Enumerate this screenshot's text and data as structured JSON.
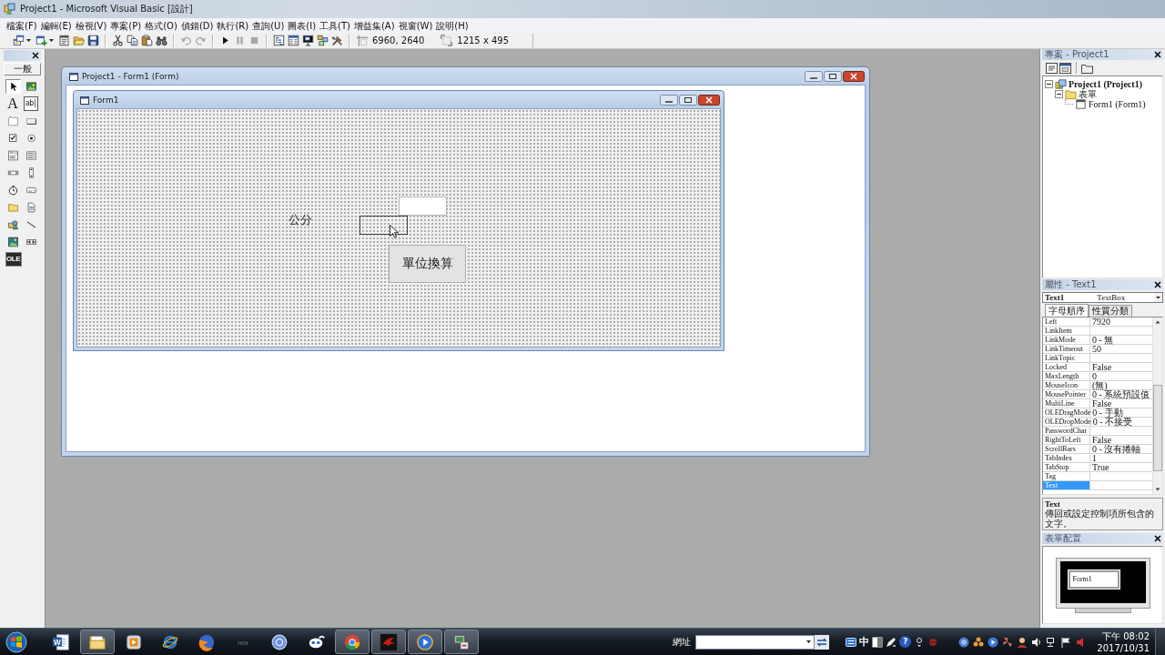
{
  "window": {
    "title": "Project1 - Microsoft Visual Basic [設計]"
  },
  "menu": [
    "檔案(F)",
    "編輯(E)",
    "檢視(V)",
    "專案(P)",
    "格式(O)",
    "偵錯(D)",
    "執行(R)",
    "查詢(U)",
    "圖表(I)",
    "工具(T)",
    "增益集(A)",
    "視窗(W)",
    "說明(H)"
  ],
  "toolbar": {
    "groups": [
      [
        {
          "kind": "addproject",
          "dropdown": true,
          "disabled": false
        },
        {
          "kind": "addform",
          "dropdown": true,
          "disabled": false
        },
        {
          "kind": "menueditor",
          "dropdown": false,
          "disabled": false
        },
        {
          "kind": "open",
          "dropdown": false,
          "disabled": false
        },
        {
          "kind": "save",
          "dropdown": false,
          "disabled": false
        }
      ],
      [
        {
          "kind": "cut",
          "dropdown": false,
          "disabled": false
        },
        {
          "kind": "copy",
          "dropdown": false,
          "disabled": false
        },
        {
          "kind": "paste",
          "dropdown": false,
          "disabled": false
        },
        {
          "kind": "find",
          "dropdown": false,
          "disabled": false
        }
      ],
      [
        {
          "kind": "undo",
          "dropdown": false,
          "disabled": true
        },
        {
          "kind": "redo",
          "dropdown": false,
          "disabled": true
        }
      ],
      [
        {
          "kind": "run",
          "dropdown": false,
          "disabled": false
        },
        {
          "kind": "pause",
          "dropdown": false,
          "disabled": true
        },
        {
          "kind": "stop",
          "dropdown": false,
          "disabled": true
        }
      ],
      [
        {
          "kind": "projectexplorer",
          "dropdown": false,
          "disabled": false
        },
        {
          "kind": "properties",
          "dropdown": false,
          "disabled": false
        },
        {
          "kind": "formlayout",
          "dropdown": false,
          "disabled": false
        },
        {
          "kind": "objectbrowser",
          "dropdown": false,
          "disabled": false
        },
        {
          "kind": "toolbox",
          "dropdown": false,
          "disabled": false
        }
      ]
    ],
    "position": "6960, 2640",
    "size": "1215 x 495"
  },
  "toolbox": {
    "tab": "一般",
    "tools": [
      {
        "kind": "pointer",
        "selected": true
      },
      {
        "kind": "picture",
        "selected": false
      },
      {
        "kind": "label",
        "glyph": "A",
        "selected": false
      },
      {
        "kind": "textbox",
        "glyph": "ab|",
        "selected": false
      },
      {
        "kind": "frame",
        "selected": false
      },
      {
        "kind": "command",
        "selected": false
      },
      {
        "kind": "check",
        "selected": false
      },
      {
        "kind": "option",
        "selected": false
      },
      {
        "kind": "combo",
        "selected": false
      },
      {
        "kind": "list",
        "selected": false
      },
      {
        "kind": "hscroll",
        "selected": false
      },
      {
        "kind": "vscroll",
        "selected": false
      },
      {
        "kind": "timer",
        "selected": false
      },
      {
        "kind": "drive",
        "selected": false
      },
      {
        "kind": "dir",
        "selected": false
      },
      {
        "kind": "file",
        "selected": false
      },
      {
        "kind": "shape",
        "selected": false
      },
      {
        "kind": "line",
        "selected": false
      },
      {
        "kind": "image",
        "selected": false
      },
      {
        "kind": "data",
        "selected": false
      },
      {
        "kind": "ole",
        "glyph": "OLE",
        "selected": false
      }
    ]
  },
  "designer": {
    "title": "Project1 - Form1 (Form)",
    "form": {
      "title": "Form1",
      "controls": [
        {
          "kind": "label",
          "text": "公分",
          "selected": false
        },
        {
          "kind": "textbox",
          "selected": false
        },
        {
          "kind": "textbox",
          "selected": true
        },
        {
          "kind": "button",
          "text": "單位換算",
          "selected": false
        }
      ]
    }
  },
  "project_explorer": {
    "title": "專案 - Project1",
    "tree": [
      {
        "kind": "project",
        "label": "Project1 (Project1)",
        "expanded": true,
        "children": [
          {
            "kind": "folder",
            "label": "表單",
            "expanded": true,
            "children": [
              {
                "kind": "form",
                "label": "Form1 (Form1)"
              }
            ]
          }
        ]
      }
    ]
  },
  "properties": {
    "title": "屬性 - Text1",
    "object": "**Text1**  TextBox",
    "tabs": [
      {
        "label": "字母順序",
        "selected": true
      },
      {
        "label": "性質分類",
        "selected": false
      }
    ],
    "rows": [
      {
        "name": "Left",
        "value": "7920",
        "selected": false
      },
      {
        "name": "LinkItem",
        "selected": false
      },
      {
        "name": "LinkMode",
        "value": "0 - 無",
        "selected": false
      },
      {
        "name": "LinkTimeout",
        "value": "50",
        "selected": false
      },
      {
        "name": "LinkTopic",
        "selected": false
      },
      {
        "name": "Locked",
        "value": "False",
        "selected": false
      },
      {
        "name": "MaxLength",
        "value": "0",
        "selected": false
      },
      {
        "name": "MouseIcon",
        "value": "(無)",
        "selected": false
      },
      {
        "name": "MousePointer",
        "value": "0 - 系統預設值",
        "selected": false
      },
      {
        "name": "MultiLine",
        "value": "False",
        "selected": false
      },
      {
        "name": "OLEDragMode",
        "value": "0 - 手動",
        "selected": false
      },
      {
        "name": "OLEDropMode",
        "value": "0 - 不接受",
        "selected": false
      },
      {
        "name": "PasswordChar",
        "selected": false
      },
      {
        "name": "RightToLeft",
        "value": "False",
        "selected": false
      },
      {
        "name": "ScrollBars",
        "value": "0 - 沒有捲軸",
        "selected": false
      },
      {
        "name": "TabIndex",
        "value": "1",
        "selected": false
      },
      {
        "name": "TabStop",
        "value": "True",
        "selected": false
      },
      {
        "name": "Tag",
        "selected": false
      },
      {
        "name": "Text",
        "selected": true
      }
    ],
    "description": {
      "title": "Text",
      "text": "傳回或設定控制項所包含的文字。"
    }
  },
  "form_layout": {
    "title": "表單配置",
    "form_label": "Form1"
  },
  "taskbar": {
    "apps": [
      {
        "kind": "document",
        "glyph": "W",
        "running": false
      },
      {
        "kind": "folder",
        "running": true
      },
      {
        "kind": "playtile",
        "running": false
      },
      {
        "kind": "orbit",
        "running": false
      },
      {
        "kind": "foxglobe",
        "running": false
      },
      {
        "kind": "wordmark",
        "glyph": "nox",
        "running": false
      },
      {
        "kind": "disc",
        "running": false
      },
      {
        "kind": "bird",
        "running": false
      },
      {
        "kind": "tricolor",
        "running": true
      },
      {
        "kind": "dragon",
        "running": true
      },
      {
        "kind": "playdisc",
        "running": true
      },
      {
        "kind": "setup",
        "running": true
      }
    ],
    "address_label": "網址",
    "language_bar": {
      "mode": "中",
      "help": "?"
    },
    "clock": {
      "time": "下午 08:02",
      "date": "2017/10/31"
    }
  }
}
